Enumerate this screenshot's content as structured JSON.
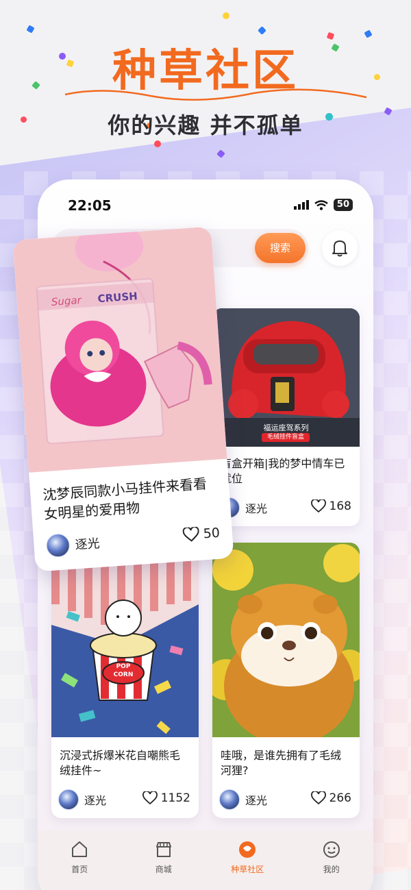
{
  "promo": {
    "headline": "种草社区",
    "subline": "你的兴趣 并不孤单"
  },
  "status_bar": {
    "time": "22:05",
    "battery": "50"
  },
  "search": {
    "button_label": "搜索"
  },
  "feed": [
    {
      "title": "沈梦辰同款小马挂件来看看女明星的爱用物",
      "author": "逐光",
      "likes": "50"
    },
    {
      "title": "盲盒开箱|我的梦中情车已就位",
      "author": "逐光",
      "likes": "168",
      "image_text": {
        "line1": "福运座驾系列",
        "line2": "毛绒挂件盲盒"
      }
    },
    {
      "title": "沉浸式拆爆米花自嘲熊毛绒挂件~",
      "author": "逐光",
      "likes": "1152"
    },
    {
      "title": "哇哦，是谁先拥有了毛绒河狸?",
      "author": "逐光",
      "likes": "266"
    }
  ],
  "featured_image_text": {
    "brand_a": "Sugar",
    "brand_b": "CRUSH"
  },
  "popcorn_text": {
    "line1": "POP",
    "line2": "CORN"
  },
  "tabbar": {
    "items": [
      {
        "label": "首页",
        "icon": "home-icon"
      },
      {
        "label": "商城",
        "icon": "shop-icon"
      },
      {
        "label": "种草社区",
        "icon": "community-icon",
        "active": true
      },
      {
        "label": "我的",
        "icon": "profile-icon"
      }
    ]
  },
  "colors": {
    "accent": "#f26a1f",
    "background_band": "#c9c6f6"
  }
}
